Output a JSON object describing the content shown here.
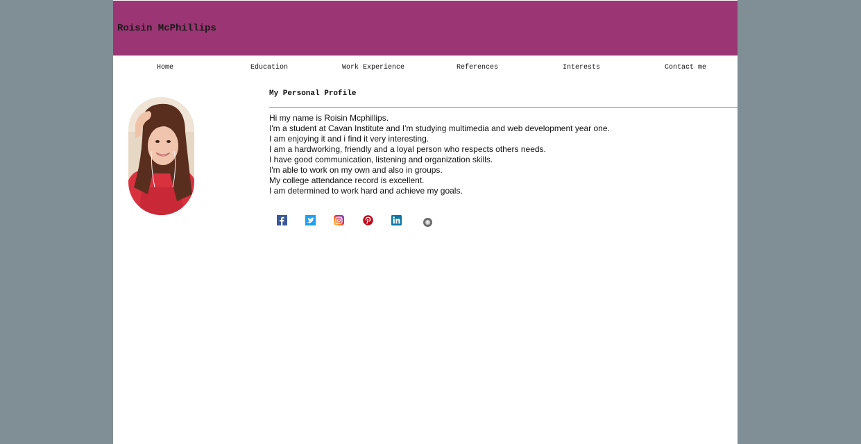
{
  "site": {
    "title": "Roisin McPhillips",
    "banner_color": "#9b3573",
    "background_color": "#808e96"
  },
  "nav": {
    "items": [
      {
        "label": "Home"
      },
      {
        "label": "Education"
      },
      {
        "label": "Work Experience"
      },
      {
        "label": "References"
      },
      {
        "label": "Interests"
      },
      {
        "label": "Contact me"
      }
    ]
  },
  "profile": {
    "heading": "My Personal Profile",
    "bio_lines": [
      "Hi my name is Roisin Mcphillips.",
      "I'm a student at Cavan Institute and I'm studying multimedia and web development year one.",
      "I am enjoying it and i find it very interesting.",
      "I am a hardworking, friendly and a loyal person who respects others needs.",
      "I have good communication, listening and organization skills.",
      "I'm able to work on my own and also in groups.",
      "My college attendance record is excellent.",
      "I am determined to work hard and achieve my goals."
    ]
  },
  "social_icons": [
    {
      "icon": "facebook-icon",
      "color": "#3b5998"
    },
    {
      "icon": "twitter-icon",
      "color": "#1da1f2"
    },
    {
      "icon": "instagram-icon",
      "color": "#c13584"
    },
    {
      "icon": "pinterest-icon",
      "color": "#bd081c"
    },
    {
      "icon": "linkedin-icon",
      "color": "#0e76a8"
    },
    {
      "icon": "circle-icon",
      "color": "#6a6a6a"
    }
  ]
}
